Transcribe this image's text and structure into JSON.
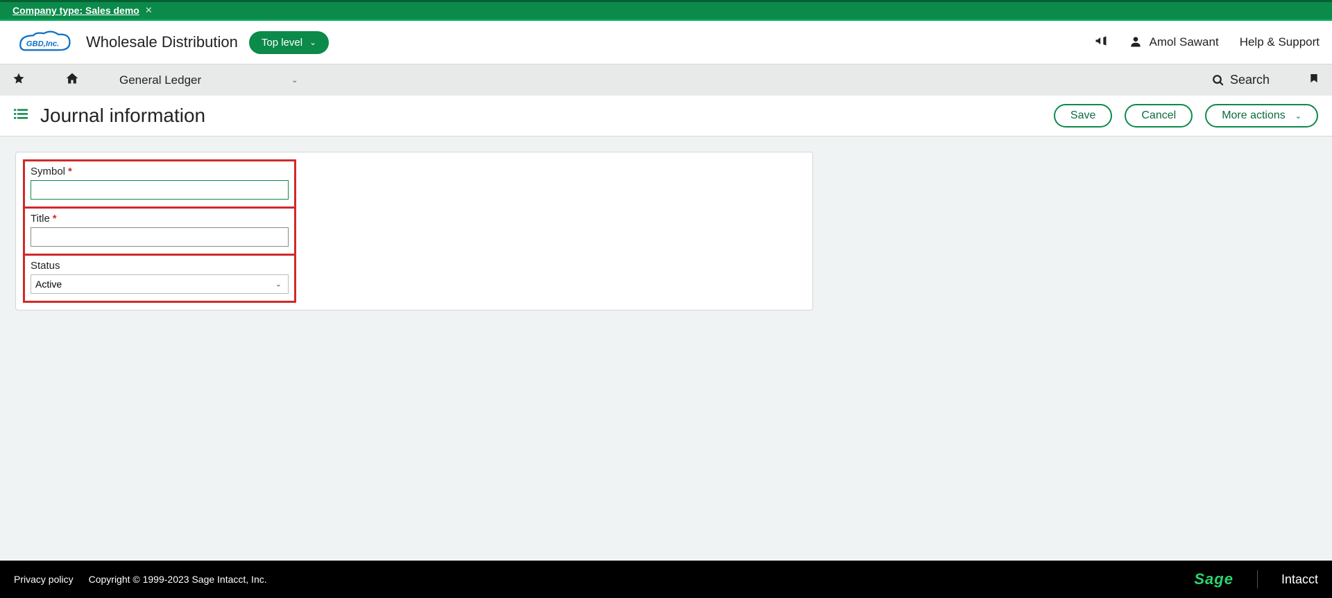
{
  "banner": {
    "company_type_label": "Company type: Sales demo"
  },
  "header": {
    "company_name": "Wholesale Distribution",
    "top_level_label": "Top level",
    "user_name": "Amol Sawant",
    "help_label": "Help & Support"
  },
  "nav": {
    "module_label": "General Ledger",
    "search_label": "Search"
  },
  "page": {
    "title": "Journal information",
    "save_label": "Save",
    "cancel_label": "Cancel",
    "more_actions_label": "More actions"
  },
  "form": {
    "symbol": {
      "label": "Symbol",
      "value": "",
      "required": true
    },
    "title": {
      "label": "Title",
      "value": "",
      "required": true
    },
    "status": {
      "label": "Status",
      "value": "Active"
    }
  },
  "footer": {
    "privacy_label": "Privacy policy",
    "copyright": "Copyright © 1999-2023 Sage Intacct, Inc.",
    "brand_primary": "Sage",
    "brand_secondary": "Intacct"
  }
}
